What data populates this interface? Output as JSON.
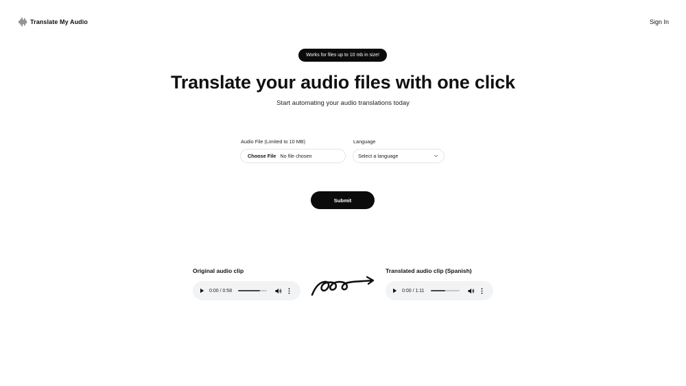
{
  "header": {
    "logo_text": "Translate My Audio",
    "signin_label": "Sign In"
  },
  "badge": "Works for files up to 10 mb in size!",
  "hero": {
    "title": "Translate your audio files with one click",
    "subtitle": "Start automating your audio translations today"
  },
  "form": {
    "file_label": "Audio File (Limited to 10 MB)",
    "file_button": "Choose File",
    "file_status": "No file chosen",
    "language_label": "Language",
    "language_placeholder": "Select a language",
    "submit_label": "Submit"
  },
  "clips": {
    "original": {
      "label": "Original audio clip",
      "time": "0:00 / 0:58",
      "volume_level": 0.75
    },
    "translated": {
      "label": "Translated audio clip (Spanish)",
      "time": "0:00 / 1:11",
      "volume_level": 0.5
    }
  },
  "colors": {
    "accent": "#0b0b0b",
    "player_bg": "#f1f3f4"
  }
}
